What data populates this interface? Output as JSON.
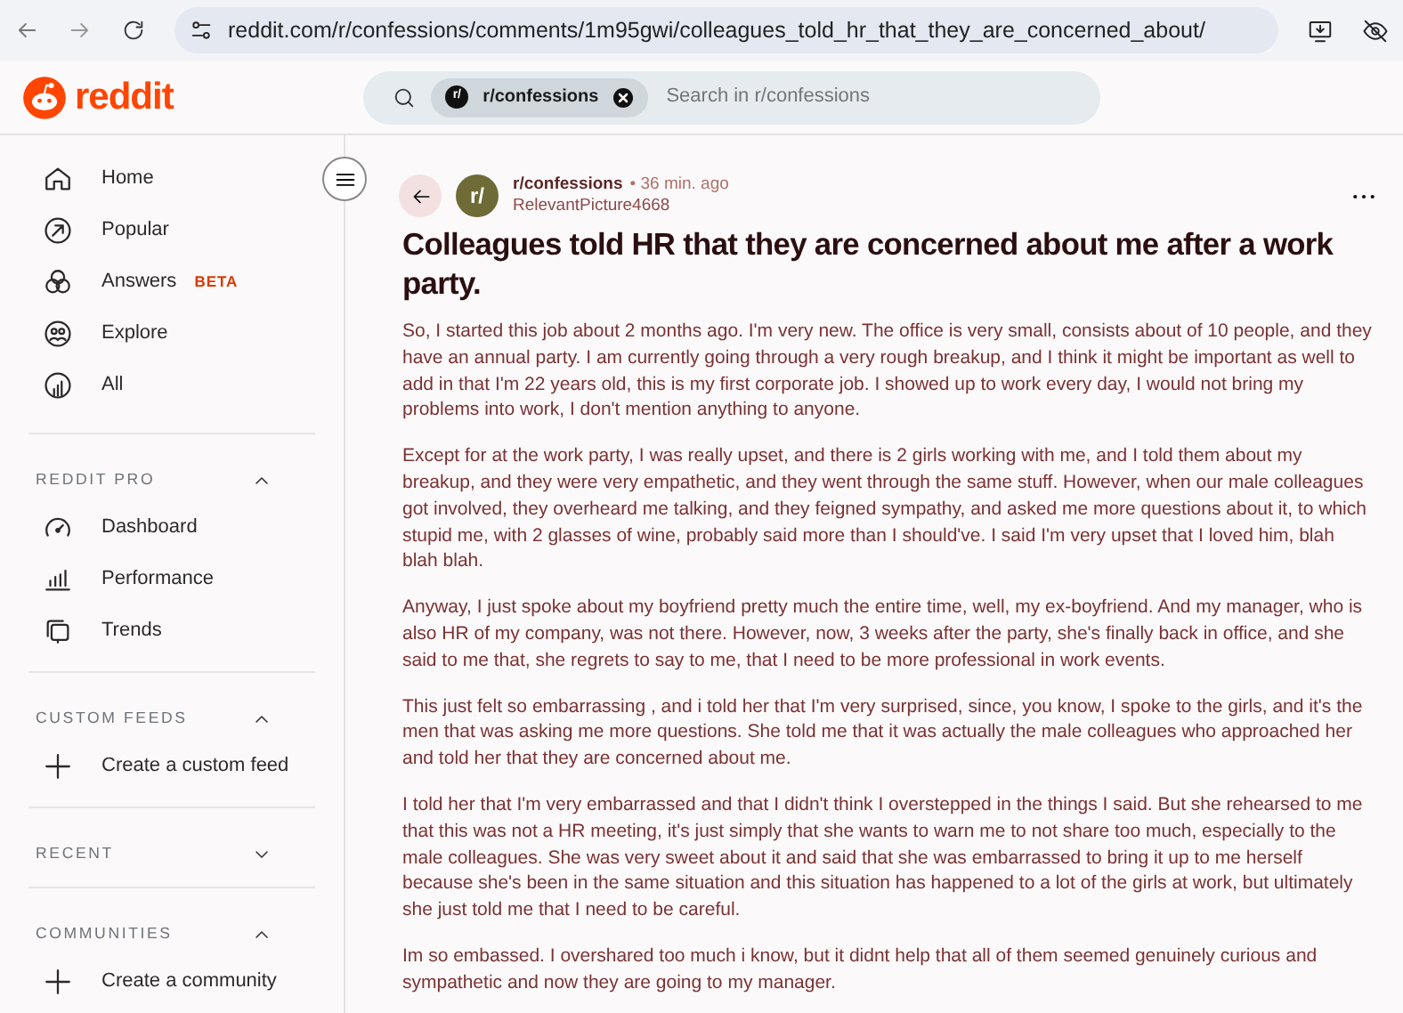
{
  "browser": {
    "url": "reddit.com/r/confessions/comments/1m95gwi/colleagues_told_hr_that_they_are_concerned_about/"
  },
  "header": {
    "logo_text": "reddit",
    "search": {
      "community_chip": "r/confessions",
      "chip_avatar": "r/",
      "placeholder": "Search in r/confessions"
    }
  },
  "sidebar": {
    "nav_items": [
      {
        "label": "Home"
      },
      {
        "label": "Popular"
      },
      {
        "label": "Answers",
        "badge": "BETA"
      },
      {
        "label": "Explore"
      },
      {
        "label": "All"
      }
    ],
    "sections": [
      {
        "title": "REDDIT PRO",
        "expanded": true,
        "items": [
          {
            "label": "Dashboard",
            "kind": "link"
          },
          {
            "label": "Performance",
            "kind": "link"
          },
          {
            "label": "Trends",
            "kind": "link"
          }
        ]
      },
      {
        "title": "CUSTOM FEEDS",
        "expanded": true,
        "items": [
          {
            "label": "Create a custom feed",
            "kind": "create"
          }
        ]
      },
      {
        "title": "RECENT",
        "expanded": false
      },
      {
        "title": "COMMUNITIES",
        "expanded": true,
        "items": [
          {
            "label": "Create a community",
            "kind": "create"
          }
        ]
      }
    ]
  },
  "post": {
    "avatar": "r/",
    "subreddit": "r/confessions",
    "time": "• 36 min. ago",
    "author": "RelevantPicture4668",
    "title": "Colleagues told HR that they are concerned about me after a work party.",
    "paragraphs": [
      "So, I started this job about 2 months ago. I'm very new. The office is very small, consists about of 10 people, and they have an annual party. I am currently going through a very rough breakup, and I think it might be important as well to add in that I'm 22 years old, this is my first corporate job. I showed up to work every day, I would not bring my problems into work, I don't mention anything to anyone.",
      "Except for at the work party, I was really upset, and there is 2 girls working with me, and I told them about my breakup, and they were very empathetic, and they went through the same stuff. However, when our male colleagues got involved, they overheard me talking, and they feigned sympathy, and asked me more questions about it, to which stupid me, with 2 glasses of wine, probably said more than I should've. I said I'm very upset that I loved him, blah blah blah.",
      "Anyway, I just spoke about my boyfriend pretty much the entire time, well, my ex-boyfriend. And my manager, who is also HR of my company, was not there. However, now, 3 weeks after the party, she's finally back in office, and she said to me that, she regrets to say to me, that I need to be more professional in work events.",
      "This just felt so embarrassing , and i told her that I'm very surprised, since, you know, I spoke to the girls, and it's the men that was asking me more questions. She told me that it was actually the male colleagues who approached her and told her that they are concerned about me.",
      "I told her that I'm very embarrassed and that I didn't think I overstepped in the things I said. But she rehearsed to me that this was not a HR meeting, it's just simply that she wants to warn me to not share too much, especially to the male colleagues. She was very sweet about it and said that she was embarrassed to bring it up to me herself because she's been in the same situation and this situation has happened to a lot of the girls at work, but ultimately she just told me that I need to be careful.",
      "Im so embassed. I overshared too much i know, but it didnt help that all of them seemed genuinely curious and sympathetic and now they are going to my manager."
    ]
  }
}
